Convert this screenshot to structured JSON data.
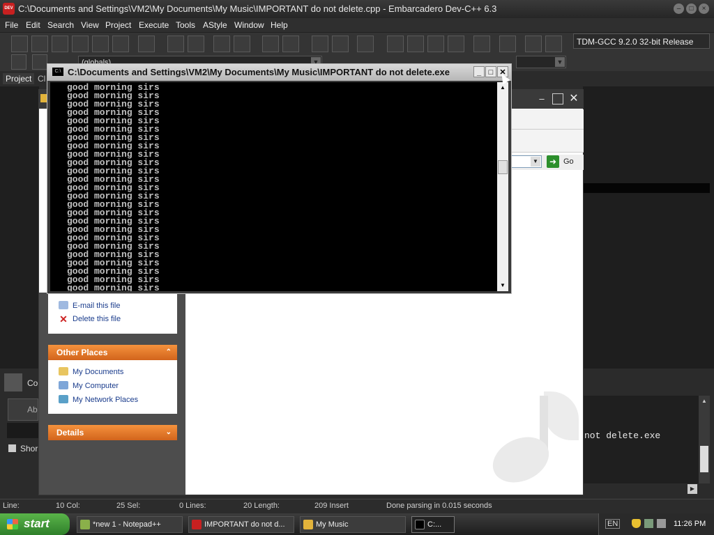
{
  "devcpp": {
    "title": "C:\\Documents and Settings\\VM2\\My Documents\\My Music\\IMPORTANT do not delete.cpp - Embarcadero Dev-C++ 6.3",
    "menu": [
      "File",
      "Edit",
      "Search",
      "View",
      "Project",
      "Execute",
      "Tools",
      "AStyle",
      "Window",
      "Help"
    ],
    "compiler": "TDM-GCC 9.2.0 32-bit Release",
    "scope_combo": "(globals)",
    "left_tabs": [
      "Project",
      "Cl"
    ],
    "bottom_left": {
      "tab": "Co",
      "button": "Ab",
      "checkbox_label": "Shor"
    },
    "output_text": "not delete.exe",
    "status": {
      "line_label": "Line:",
      "col": "10 Col:",
      "sel": "25 Sel:",
      "lines": "0 Lines:",
      "length": "20 Length:",
      "insert": "209 Insert",
      "message": "Done parsing in 0.015 seconds"
    }
  },
  "console": {
    "title": "C:\\Documents and Settings\\VM2\\My Documents\\My Music\\IMPORTANT do not delete.exe",
    "icon_text": "C:\\",
    "lines": [
      "good morning sirs",
      "good morning sirs",
      "good morning sirs",
      "good morning sirs",
      "good morning sirs",
      "good morning sirs",
      "good morning sirs",
      "good morning sirs",
      "good morning sirs",
      "good morning sirs",
      "good morning sirs",
      "good morning sirs",
      "good morning sirs",
      "good morning sirs",
      "good morning sirs",
      "good morning sirs",
      "good morning sirs",
      "good morning sirs",
      "good morning sirs",
      "good morning sirs",
      "good morning sirs",
      "good morning sirs",
      "good morning sirs",
      "good morning sirs",
      "good morning sirs"
    ]
  },
  "explorer": {
    "file_tasks": [
      "E-mail this file",
      "Delete this file"
    ],
    "other_places_header": "Other Places",
    "other_places": [
      "My Documents",
      "My Computer",
      "My Network Places"
    ],
    "details_header": "Details",
    "go_label": "Go"
  },
  "taskbar": {
    "start_label": "start",
    "items": [
      "*new 1 - Notepad++",
      "IMPORTANT do not d...",
      "My Music",
      "C:..."
    ],
    "lang": "EN",
    "time": "11:26 PM"
  }
}
